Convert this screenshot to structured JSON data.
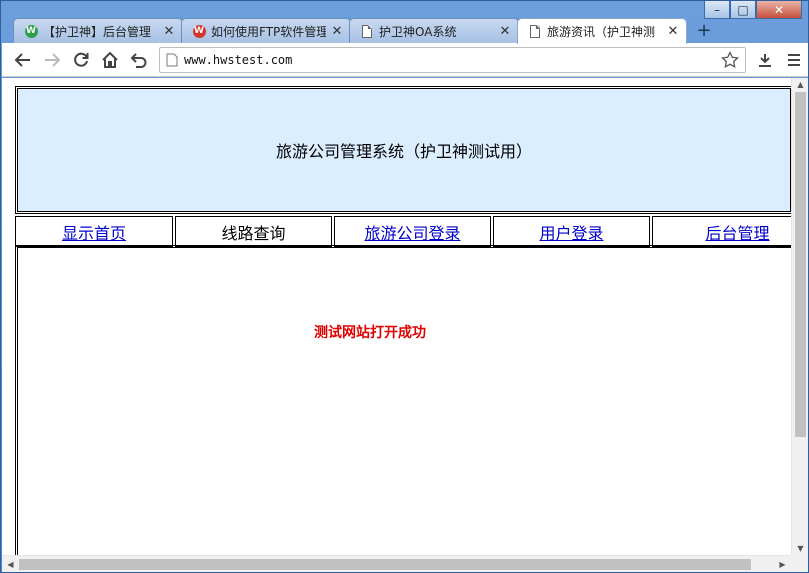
{
  "window": {
    "controls": {
      "minimize": "–",
      "maximize": "□",
      "close": "✕"
    }
  },
  "tabs": [
    {
      "title": "【护卫神】后台管理",
      "icon": "green-w-shield",
      "active": false
    },
    {
      "title": "如何使用FTP软件管理",
      "icon": "red-w-shield",
      "active": false
    },
    {
      "title": "护卫神OA系统",
      "icon": "document",
      "active": false
    },
    {
      "title": "旅游资讯（护卫神测",
      "icon": "document",
      "active": true
    }
  ],
  "tab_close_glyph": "✕",
  "new_tab_glyph": "+",
  "toolbar": {
    "url": "www.hwstest.com"
  },
  "page": {
    "header_title": "旅游公司管理系统（护卫神测试用）",
    "nav": [
      {
        "label": "显示首页",
        "link": true
      },
      {
        "label": "线路查询",
        "link": false
      },
      {
        "label": "旅游公司登录",
        "link": true
      },
      {
        "label": "用户登录",
        "link": true
      },
      {
        "label": "后台管理",
        "link": true
      }
    ],
    "success_message": "测试网站打开成功"
  },
  "colors": {
    "header_bg": "#dbeeff",
    "link": "#0000cc",
    "success": "#e00000",
    "window_frame": "#5b8fd0"
  }
}
